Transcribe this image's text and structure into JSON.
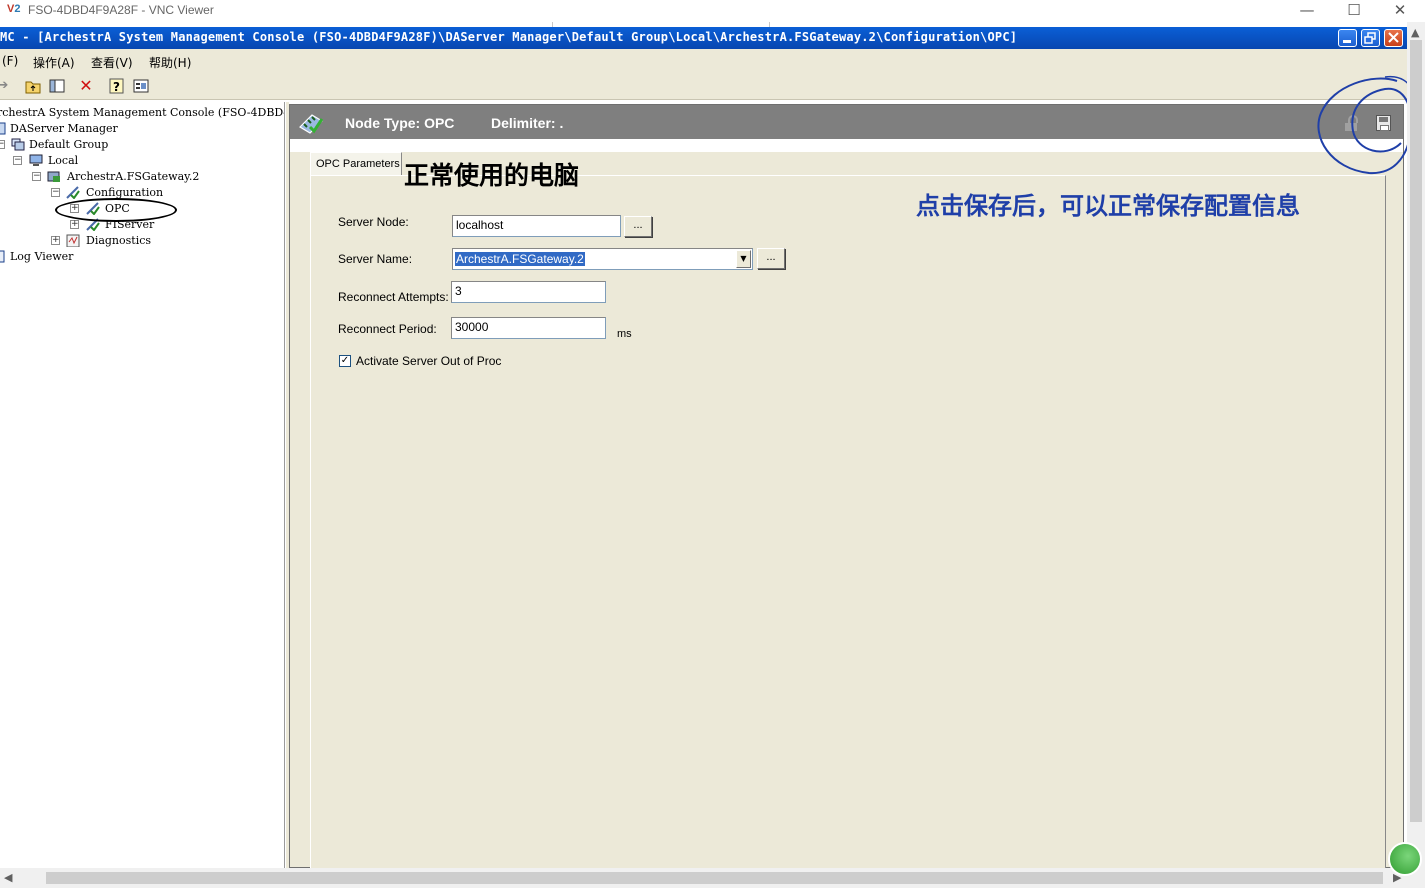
{
  "vnc": {
    "title": "FSO-4DBD4F9A28F - VNC Viewer",
    "minimize": "—",
    "maximize": "☐",
    "close": "✕"
  },
  "mmc": {
    "title": "MC - [ArchestrA System Management Console (FSO-4DBD4F9A28F)\\DAServer Manager\\Default Group\\Local\\ArchestrA.FSGateway.2\\Configuration\\OPC]"
  },
  "menu": {
    "file": "(F)",
    "action": "操作(A)",
    "view": "查看(V)",
    "help": "帮助(H)"
  },
  "tree": {
    "root": "rchestrA System Management Console (FSO-4DBD4F9A",
    "daserver_manager": "DAServer Manager",
    "default_group": "Default Group",
    "local": "Local",
    "gateway": "ArchestrA.FSGateway.2",
    "configuration": "Configuration",
    "opc": "OPC",
    "fiserver": "FIServer",
    "diagnostics": "Diagnostics",
    "log_viewer": "Log Viewer"
  },
  "header": {
    "node_type": "Node Type: OPC",
    "delimiter": "Delimiter:  ."
  },
  "tab": {
    "label": "OPC Parameters"
  },
  "form": {
    "server_node_label": "Server Node:",
    "server_node_value": "localhost",
    "server_name_label": "Server Name:",
    "server_name_value": "ArchestrA.FSGateway.2",
    "reconnect_attempts_label": "Reconnect Attempts:",
    "reconnect_attempts_value": "3",
    "reconnect_period_label": "Reconnect Period:",
    "reconnect_period_value": "30000",
    "reconnect_period_unit": "ms",
    "activate_label": "Activate Server Out of Proc",
    "activate_checked": true,
    "browse_label": "..."
  },
  "annotations": {
    "left": "正常使用的电脑",
    "right": "点击保存后，可以正常保存配置信息"
  },
  "colors": {
    "title_blue": "#0a5fd6",
    "panel_bg": "#ece9d8",
    "header_gray": "#7f7f7f",
    "annotation_blue": "#1f3fa8"
  }
}
